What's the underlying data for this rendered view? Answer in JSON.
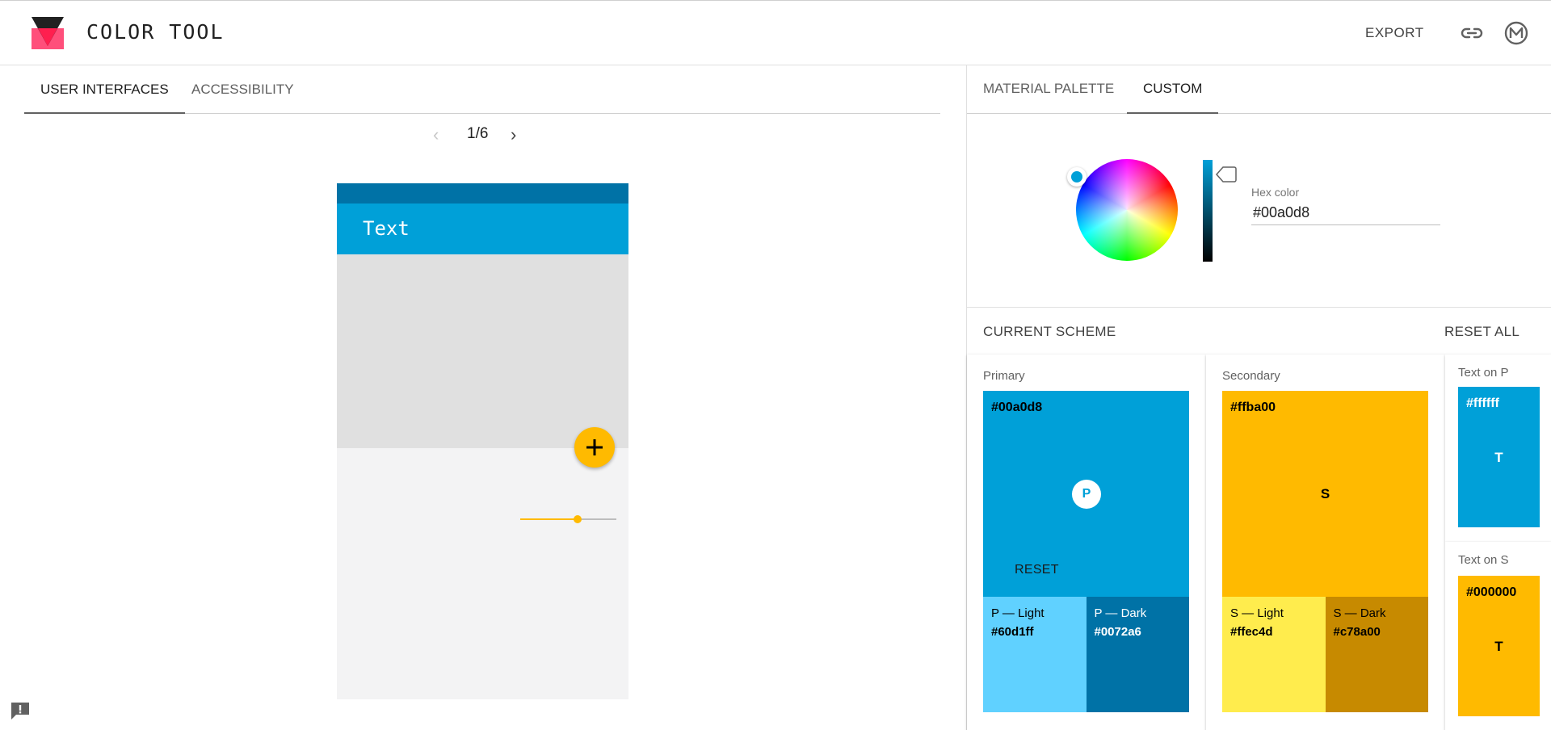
{
  "app": {
    "title": "COLOR TOOL",
    "export_label": "EXPORT",
    "icons": [
      "logo-icon",
      "link-icon",
      "material-icon",
      "feedback-icon"
    ]
  },
  "left_panel": {
    "tabs": [
      {
        "label": "USER INTERFACES",
        "active": true
      },
      {
        "label": "ACCESSIBILITY",
        "active": false
      }
    ],
    "pager": {
      "label": "1/6",
      "prev_icon": "chevron-left-icon",
      "next_icon": "chevron-right-icon"
    },
    "phone": {
      "app_bar_text": "Text",
      "fab_icon": "plus-icon",
      "slider_value": 0.6
    }
  },
  "right_panel": {
    "tabs": [
      {
        "label": "MATERIAL PALETTE",
        "active": false
      },
      {
        "label": "CUSTOM",
        "active": true
      }
    ],
    "picker": {
      "hex_label": "Hex color",
      "hex_value": "#00a0d8"
    },
    "scheme": {
      "title": "CURRENT SCHEME",
      "reset_all_label": "RESET ALL",
      "primary": {
        "label": "Primary",
        "hex": "#00a0d8",
        "badge": "P",
        "reset_label": "RESET",
        "light": {
          "name": "P — Light",
          "hex": "#60d1ff"
        },
        "dark": {
          "name": "P — Dark",
          "hex": "#0072a6"
        }
      },
      "secondary": {
        "label": "Secondary",
        "hex": "#ffba00",
        "letter": "S",
        "light": {
          "name": "S — Light",
          "hex": "#ffec4d"
        },
        "dark": {
          "name": "S — Dark",
          "hex": "#c78a00"
        }
      },
      "text_on_p": {
        "label": "Text on P",
        "hex": "#ffffff",
        "letter": "T"
      },
      "text_on_s": {
        "label": "Text on S",
        "hex": "#000000",
        "letter": "T"
      }
    }
  },
  "colors": {
    "primary": "#00a0d8",
    "primary_light": "#60d1ff",
    "primary_dark": "#0072a6",
    "secondary": "#ffba00",
    "secondary_light": "#ffec4d",
    "secondary_dark": "#c78a00",
    "text_on_primary": "#ffffff",
    "text_on_secondary": "#000000",
    "phone_surface": "#e0e0e0"
  }
}
